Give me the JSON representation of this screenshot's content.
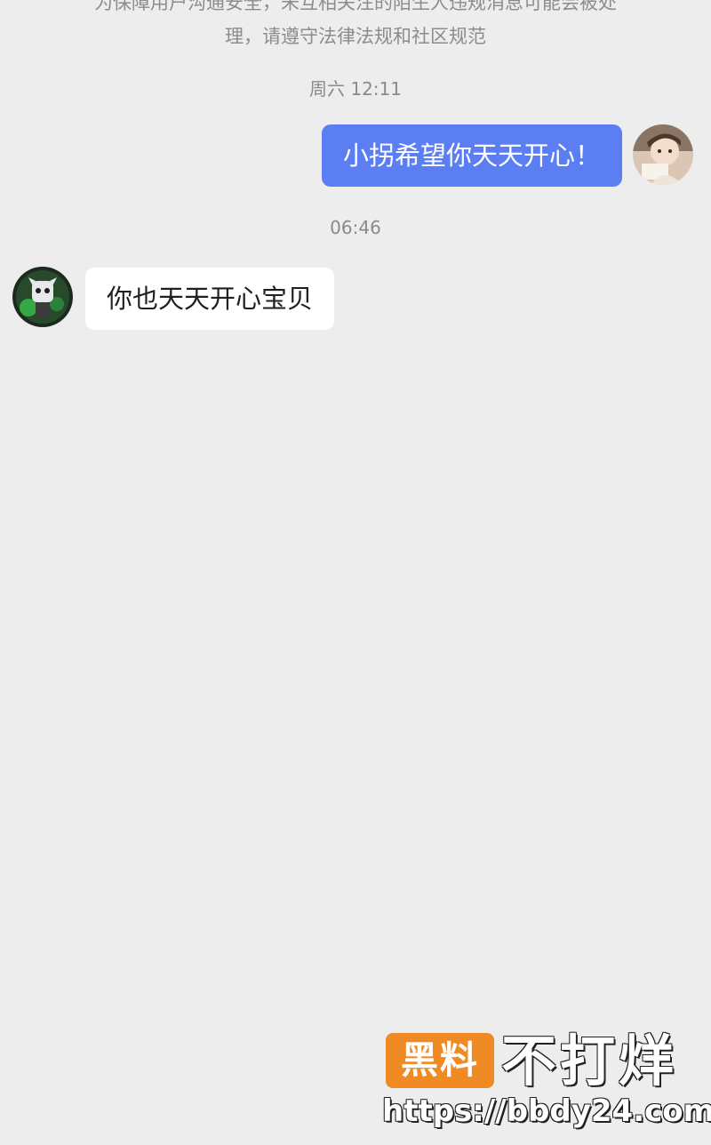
{
  "notice": {
    "line1": "为保障用户沟通安全，未互相关注的陌生人违规消息可能会被处",
    "line2": "理，请遵守法律法规和社区规范"
  },
  "messages": [
    {
      "timestamp": "周六 12:11",
      "sender": "me",
      "text": "小拐希望你天天开心！"
    },
    {
      "timestamp": "06:46",
      "sender": "other",
      "text": "你也天天开心宝贝"
    }
  ],
  "watermark": {
    "badge": "黑料",
    "title": "不打烊",
    "url": "https://bbdy24.com"
  },
  "colors": {
    "background": "#ededed",
    "outgoing_bubble": "#5b7ef2",
    "incoming_bubble": "#ffffff",
    "badge": "#f08a24"
  }
}
